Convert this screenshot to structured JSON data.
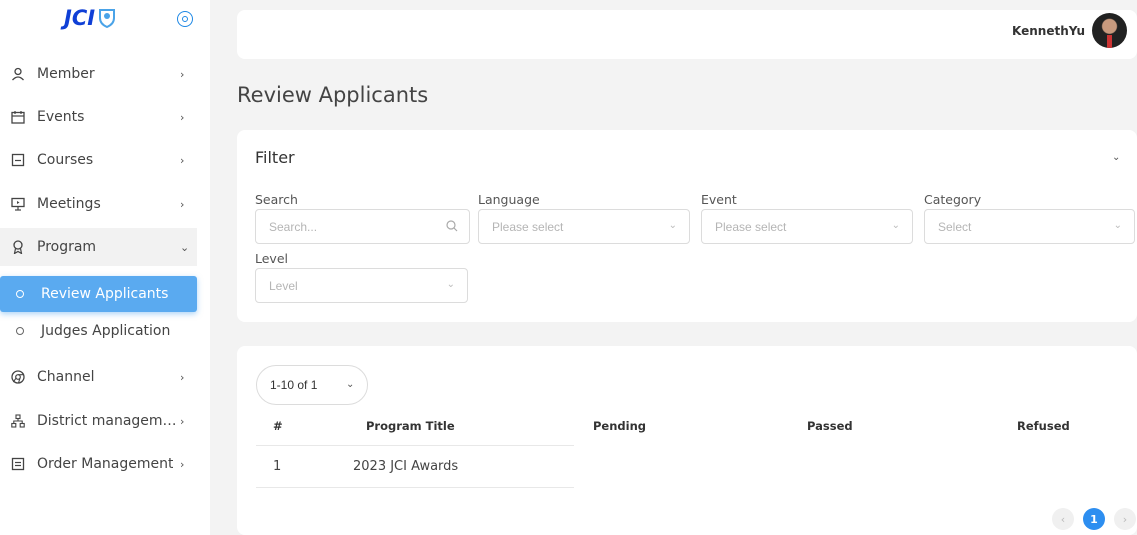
{
  "brand": {
    "logo_text": "JCI"
  },
  "sidebar": {
    "items": [
      {
        "label": "Member"
      },
      {
        "label": "Events"
      },
      {
        "label": "Courses"
      },
      {
        "label": "Meetings"
      },
      {
        "label": "Program"
      },
      {
        "label": "Channel"
      },
      {
        "label": "District manageme..."
      },
      {
        "label": "Order Management"
      }
    ],
    "program_sub": [
      {
        "label": "Review Applicants",
        "active": true
      },
      {
        "label": "Judges Application",
        "active": false
      }
    ]
  },
  "header": {
    "username": "KennethYu"
  },
  "page": {
    "title": "Review Applicants"
  },
  "filter": {
    "title": "Filter",
    "fields": {
      "search": {
        "label": "Search",
        "placeholder": "Search..."
      },
      "language": {
        "label": "Language",
        "placeholder": "Please select"
      },
      "event": {
        "label": "Event",
        "placeholder": "Please select"
      },
      "category": {
        "label": "Category",
        "placeholder": "Select"
      },
      "level": {
        "label": "Level",
        "placeholder": "Level"
      }
    }
  },
  "table": {
    "page_size_label": "1-10 of 1",
    "headers": [
      "#",
      "Program Title",
      "Pending",
      "Passed",
      "Refused"
    ],
    "rows": [
      {
        "index": "1",
        "program_title": "2023 JCI Awards"
      }
    ]
  },
  "pagination": {
    "current": "1",
    "prev": "‹",
    "next": "›"
  },
  "colors": {
    "accent": "#2d8ef0",
    "active_menu": "#5aaaf0",
    "logo": "#0f3fd6"
  }
}
